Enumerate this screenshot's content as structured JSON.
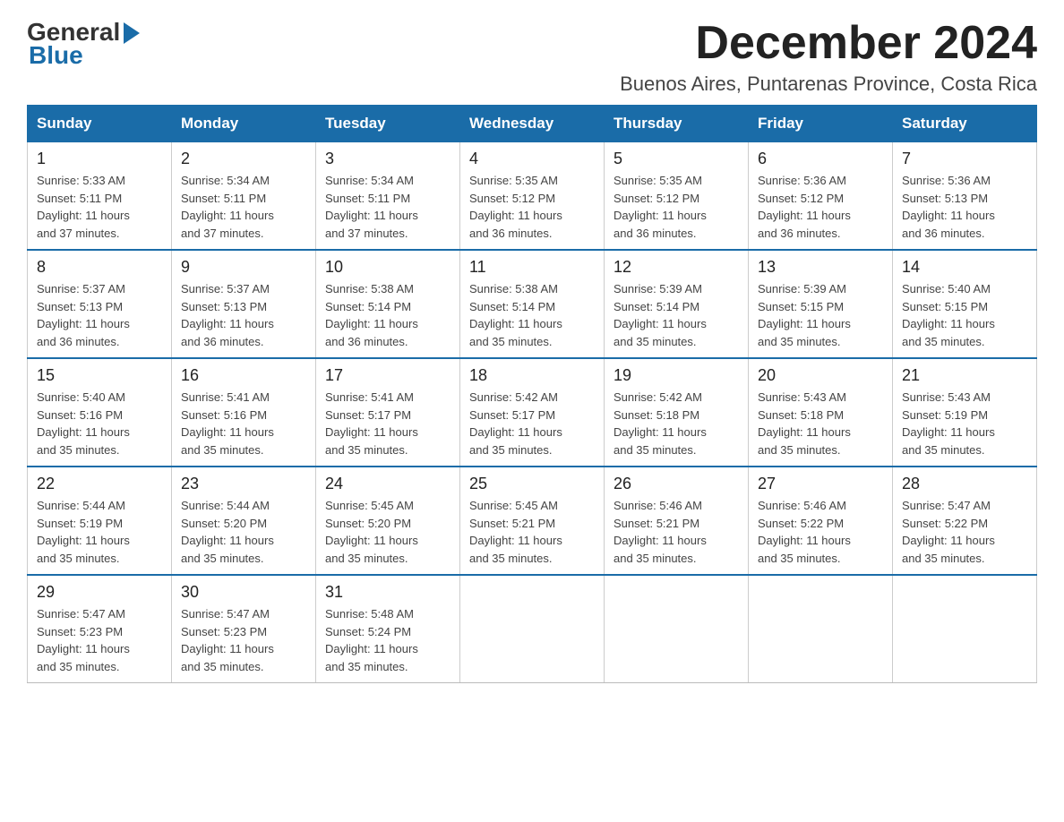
{
  "logo": {
    "general": "General",
    "blue": "Blue"
  },
  "title": {
    "month": "December 2024",
    "location": "Buenos Aires, Puntarenas Province, Costa Rica"
  },
  "weekdays": [
    "Sunday",
    "Monday",
    "Tuesday",
    "Wednesday",
    "Thursday",
    "Friday",
    "Saturday"
  ],
  "weeks": [
    [
      {
        "day": "1",
        "sunrise": "5:33 AM",
        "sunset": "5:11 PM",
        "daylight": "11 hours and 37 minutes."
      },
      {
        "day": "2",
        "sunrise": "5:34 AM",
        "sunset": "5:11 PM",
        "daylight": "11 hours and 37 minutes."
      },
      {
        "day": "3",
        "sunrise": "5:34 AM",
        "sunset": "5:11 PM",
        "daylight": "11 hours and 37 minutes."
      },
      {
        "day": "4",
        "sunrise": "5:35 AM",
        "sunset": "5:12 PM",
        "daylight": "11 hours and 36 minutes."
      },
      {
        "day": "5",
        "sunrise": "5:35 AM",
        "sunset": "5:12 PM",
        "daylight": "11 hours and 36 minutes."
      },
      {
        "day": "6",
        "sunrise": "5:36 AM",
        "sunset": "5:12 PM",
        "daylight": "11 hours and 36 minutes."
      },
      {
        "day": "7",
        "sunrise": "5:36 AM",
        "sunset": "5:13 PM",
        "daylight": "11 hours and 36 minutes."
      }
    ],
    [
      {
        "day": "8",
        "sunrise": "5:37 AM",
        "sunset": "5:13 PM",
        "daylight": "11 hours and 36 minutes."
      },
      {
        "day": "9",
        "sunrise": "5:37 AM",
        "sunset": "5:13 PM",
        "daylight": "11 hours and 36 minutes."
      },
      {
        "day": "10",
        "sunrise": "5:38 AM",
        "sunset": "5:14 PM",
        "daylight": "11 hours and 36 minutes."
      },
      {
        "day": "11",
        "sunrise": "5:38 AM",
        "sunset": "5:14 PM",
        "daylight": "11 hours and 35 minutes."
      },
      {
        "day": "12",
        "sunrise": "5:39 AM",
        "sunset": "5:14 PM",
        "daylight": "11 hours and 35 minutes."
      },
      {
        "day": "13",
        "sunrise": "5:39 AM",
        "sunset": "5:15 PM",
        "daylight": "11 hours and 35 minutes."
      },
      {
        "day": "14",
        "sunrise": "5:40 AM",
        "sunset": "5:15 PM",
        "daylight": "11 hours and 35 minutes."
      }
    ],
    [
      {
        "day": "15",
        "sunrise": "5:40 AM",
        "sunset": "5:16 PM",
        "daylight": "11 hours and 35 minutes."
      },
      {
        "day": "16",
        "sunrise": "5:41 AM",
        "sunset": "5:16 PM",
        "daylight": "11 hours and 35 minutes."
      },
      {
        "day": "17",
        "sunrise": "5:41 AM",
        "sunset": "5:17 PM",
        "daylight": "11 hours and 35 minutes."
      },
      {
        "day": "18",
        "sunrise": "5:42 AM",
        "sunset": "5:17 PM",
        "daylight": "11 hours and 35 minutes."
      },
      {
        "day": "19",
        "sunrise": "5:42 AM",
        "sunset": "5:18 PM",
        "daylight": "11 hours and 35 minutes."
      },
      {
        "day": "20",
        "sunrise": "5:43 AM",
        "sunset": "5:18 PM",
        "daylight": "11 hours and 35 minutes."
      },
      {
        "day": "21",
        "sunrise": "5:43 AM",
        "sunset": "5:19 PM",
        "daylight": "11 hours and 35 minutes."
      }
    ],
    [
      {
        "day": "22",
        "sunrise": "5:44 AM",
        "sunset": "5:19 PM",
        "daylight": "11 hours and 35 minutes."
      },
      {
        "day": "23",
        "sunrise": "5:44 AM",
        "sunset": "5:20 PM",
        "daylight": "11 hours and 35 minutes."
      },
      {
        "day": "24",
        "sunrise": "5:45 AM",
        "sunset": "5:20 PM",
        "daylight": "11 hours and 35 minutes."
      },
      {
        "day": "25",
        "sunrise": "5:45 AM",
        "sunset": "5:21 PM",
        "daylight": "11 hours and 35 minutes."
      },
      {
        "day": "26",
        "sunrise": "5:46 AM",
        "sunset": "5:21 PM",
        "daylight": "11 hours and 35 minutes."
      },
      {
        "day": "27",
        "sunrise": "5:46 AM",
        "sunset": "5:22 PM",
        "daylight": "11 hours and 35 minutes."
      },
      {
        "day": "28",
        "sunrise": "5:47 AM",
        "sunset": "5:22 PM",
        "daylight": "11 hours and 35 minutes."
      }
    ],
    [
      {
        "day": "29",
        "sunrise": "5:47 AM",
        "sunset": "5:23 PM",
        "daylight": "11 hours and 35 minutes."
      },
      {
        "day": "30",
        "sunrise": "5:47 AM",
        "sunset": "5:23 PM",
        "daylight": "11 hours and 35 minutes."
      },
      {
        "day": "31",
        "sunrise": "5:48 AM",
        "sunset": "5:24 PM",
        "daylight": "11 hours and 35 minutes."
      },
      null,
      null,
      null,
      null
    ]
  ],
  "labels": {
    "sunrise": "Sunrise:",
    "sunset": "Sunset:",
    "daylight": "Daylight:"
  },
  "colors": {
    "header_bg": "#1a6ca8",
    "header_text": "#ffffff",
    "border": "#1a6ca8"
  }
}
